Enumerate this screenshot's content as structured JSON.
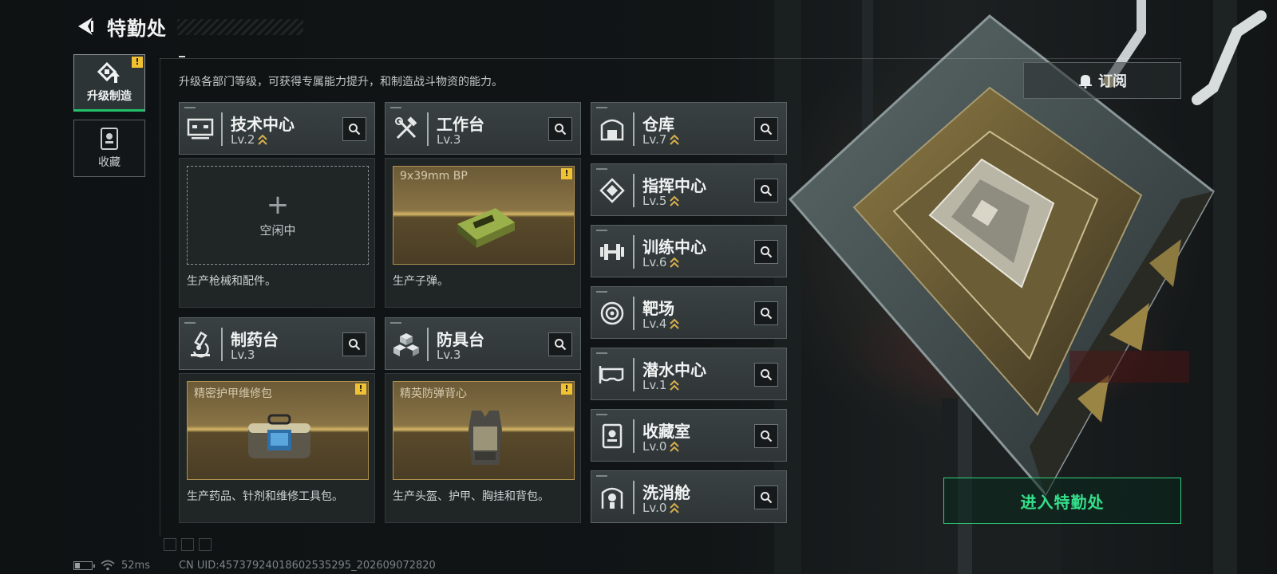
{
  "header": {
    "title": "特勤处",
    "back_icon": "back-chevron-icon"
  },
  "sidebar": {
    "tabs": [
      {
        "label": "升级制造",
        "icon": "upgrade-craft-icon",
        "active": true,
        "alert": "!"
      },
      {
        "label": "收藏",
        "icon": "collection-icon",
        "active": false
      }
    ]
  },
  "description": "升级各部门等级，可获得专属能力提升，和制造战斗物资的能力。",
  "production_stations": [
    {
      "name": "技术中心",
      "level": "Lv.2",
      "icon": "monitor-icon",
      "slot_state": "idle",
      "slot_text": "空闲中",
      "description": "生产枪械和配件。"
    },
    {
      "name": "工作台",
      "level": "Lv.3",
      "icon": "tools-icon",
      "slot_state": "producing",
      "slot_item": "9x39mm BP",
      "slot_alert": "!",
      "description": "生产子弹。"
    },
    {
      "name": "制药台",
      "level": "Lv.3",
      "icon": "microscope-icon",
      "slot_state": "producing",
      "slot_item": "精密护甲维修包",
      "slot_alert": "!",
      "description": "生产药品、针剂和维修工具包。"
    },
    {
      "name": "防具台",
      "level": "Lv.3",
      "icon": "armor-blocks-icon",
      "slot_state": "producing",
      "slot_item": "精英防弹背心",
      "slot_alert": "!",
      "description": "生产头盔、护甲、胸挂和背包。"
    }
  ],
  "facilities": [
    {
      "name": "仓库",
      "level": "Lv.7",
      "icon": "warehouse-icon"
    },
    {
      "name": "指挥中心",
      "level": "Lv.5",
      "icon": "command-icon"
    },
    {
      "name": "训练中心",
      "level": "Lv.6",
      "icon": "dumbbell-icon"
    },
    {
      "name": "靶场",
      "level": "Lv.4",
      "icon": "target-icon"
    },
    {
      "name": "潜水中心",
      "level": "Lv.1",
      "icon": "diving-mask-icon"
    },
    {
      "name": "收藏室",
      "level": "Lv.0",
      "icon": "collection-room-icon"
    },
    {
      "name": "洗消舱",
      "level": "Lv.0",
      "icon": "decontamination-icon"
    }
  ],
  "subscribe_label": "订阅",
  "enter_label": "进入特勤处",
  "status": {
    "ping": "52ms",
    "uid": "CN UID:45737924018602535295_202609072820"
  },
  "colors": {
    "accent_green": "#2ed27c",
    "alert_yellow": "#f0c232",
    "upgrade_gold": "#d8b04a"
  }
}
